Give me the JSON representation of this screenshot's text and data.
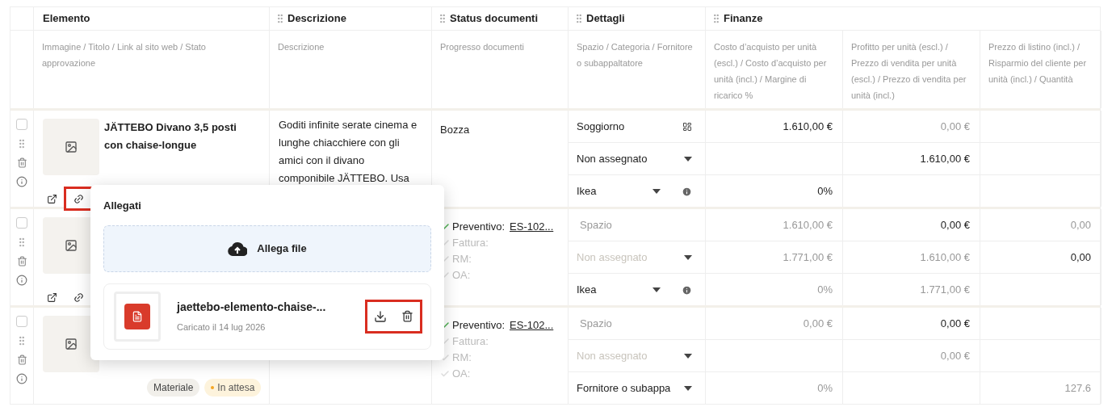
{
  "header": {
    "groups": [
      {
        "label": "Elemento",
        "draggable": false,
        "columns": [
          "Immagine / Titolo / Link al sito web / Stato approvazione"
        ]
      },
      {
        "label": "Descrizione",
        "draggable": true,
        "columns": [
          "Descrizione"
        ]
      },
      {
        "label": "Status documenti",
        "draggable": true,
        "columns": [
          "Progresso documenti"
        ]
      },
      {
        "label": "Dettagli",
        "draggable": true,
        "columns": [
          "Spazio / Categoria / Fornitore o subappaltatore"
        ]
      },
      {
        "label": "Finanze",
        "draggable": true,
        "columns": [
          "Costo d’acquisto per unità (escl.) / Costo d’acquisto per unità (incl.) / Margine di ricarico %",
          "Profitto per unità (escl.) / Prezzo di vendita per unità (escl.) / Prezzo di vendita per unità (incl.)",
          "Prezzo di listino (incl.) / Risparmio del cliente per unità (incl.) / Quantità"
        ]
      }
    ]
  },
  "rows": [
    {
      "checked": false,
      "title": "JÄTTEBO Divano 3,5 posti con chaise-longue",
      "link_icons": true,
      "link_highlighted": true,
      "description": "Goditi infinite serate cinema e lunghe chiacchiere con gli amici con il divano componibile JÄTTEBO. Usa",
      "status": {
        "kind": "text",
        "text": "Bozza"
      },
      "details": [
        {
          "text": "Soggiorno",
          "muted": false,
          "placeholder": false,
          "kind": "grid"
        },
        {
          "text": "Non assegnato",
          "muted": false,
          "placeholder": false,
          "kind": "caret"
        },
        {
          "text": "Ikea",
          "muted": false,
          "placeholder": false,
          "kind": "caret-info"
        }
      ],
      "finance": [
        {
          "cost": {
            "text": "1.610,00 €",
            "muted": false
          },
          "profit": {
            "text": "0,00 €",
            "muted": true
          }
        },
        {
          "profit": {
            "text": "1.610,00 €",
            "muted": false
          }
        },
        {
          "cost": {
            "text": "0%",
            "muted": false
          }
        }
      ]
    },
    {
      "checked": false,
      "link_icons": true,
      "link_highlighted": false,
      "status": {
        "kind": "docs",
        "items": [
          {
            "label": "Preventivo:",
            "checked": true,
            "link": "ES-102..."
          },
          {
            "label": "Fattura:",
            "checked": false
          },
          {
            "label": "RM:",
            "checked": false
          },
          {
            "label": "OA:",
            "checked": false
          }
        ]
      },
      "details": [
        {
          "text": "Spazio",
          "muted": true,
          "placeholder": false,
          "kind": "none"
        },
        {
          "text": "Non assegnato",
          "muted": false,
          "placeholder": true,
          "kind": "caret"
        },
        {
          "text": "Ikea",
          "muted": false,
          "placeholder": false,
          "kind": "caret-info"
        }
      ],
      "finance": [
        {
          "cost": {
            "text": "1.610,00 €",
            "muted": true
          },
          "profit": {
            "text": "0,00 €",
            "muted": false
          },
          "list": {
            "text": "0,00",
            "muted": true
          }
        },
        {
          "cost": {
            "text": "1.771,00 €",
            "muted": true
          },
          "profit": {
            "text": "1.610,00 €",
            "muted": true
          },
          "list": {
            "text": "0,00",
            "muted": false
          }
        },
        {
          "cost": {
            "text": "0%",
            "muted": true
          },
          "profit": {
            "text": "1.771,00 €",
            "muted": true
          }
        }
      ]
    },
    {
      "checked": false,
      "link_icons": false,
      "tags": [
        {
          "label": "Materiale"
        },
        {
          "label": "In attesa",
          "color": "#f5a623"
        }
      ],
      "status": {
        "kind": "docs",
        "items": [
          {
            "label": "Preventivo:",
            "checked": true,
            "link": "ES-102..."
          },
          {
            "label": "Fattura:",
            "checked": false
          },
          {
            "label": "RM:",
            "checked": false
          },
          {
            "label": "OA:",
            "checked": false
          }
        ]
      },
      "details": [
        {
          "text": "Spazio",
          "muted": true,
          "placeholder": false,
          "kind": "none"
        },
        {
          "text": "Non assegnato",
          "muted": false,
          "placeholder": true,
          "kind": "caret"
        },
        {
          "text": "Fornitore o subappa",
          "muted": false,
          "placeholder": false,
          "kind": "caret"
        }
      ],
      "finance": [
        {
          "cost": {
            "text": "0,00 €",
            "muted": true
          },
          "profit": {
            "text": "0,00 €",
            "muted": false
          }
        },
        {
          "profit": {
            "text": "0,00 €",
            "muted": true
          }
        },
        {
          "cost": {
            "text": "0%",
            "muted": true
          },
          "list": {
            "text": "127.6",
            "muted": true
          }
        }
      ]
    }
  ],
  "popover": {
    "title": "Allegati",
    "upload_label": "Allega file",
    "file": {
      "name": "jaettebo-elemento-chaise-...",
      "uploaded": "Caricato il 14 lug 2026",
      "icon_highlighted": true,
      "actions_highlighted": true
    }
  }
}
